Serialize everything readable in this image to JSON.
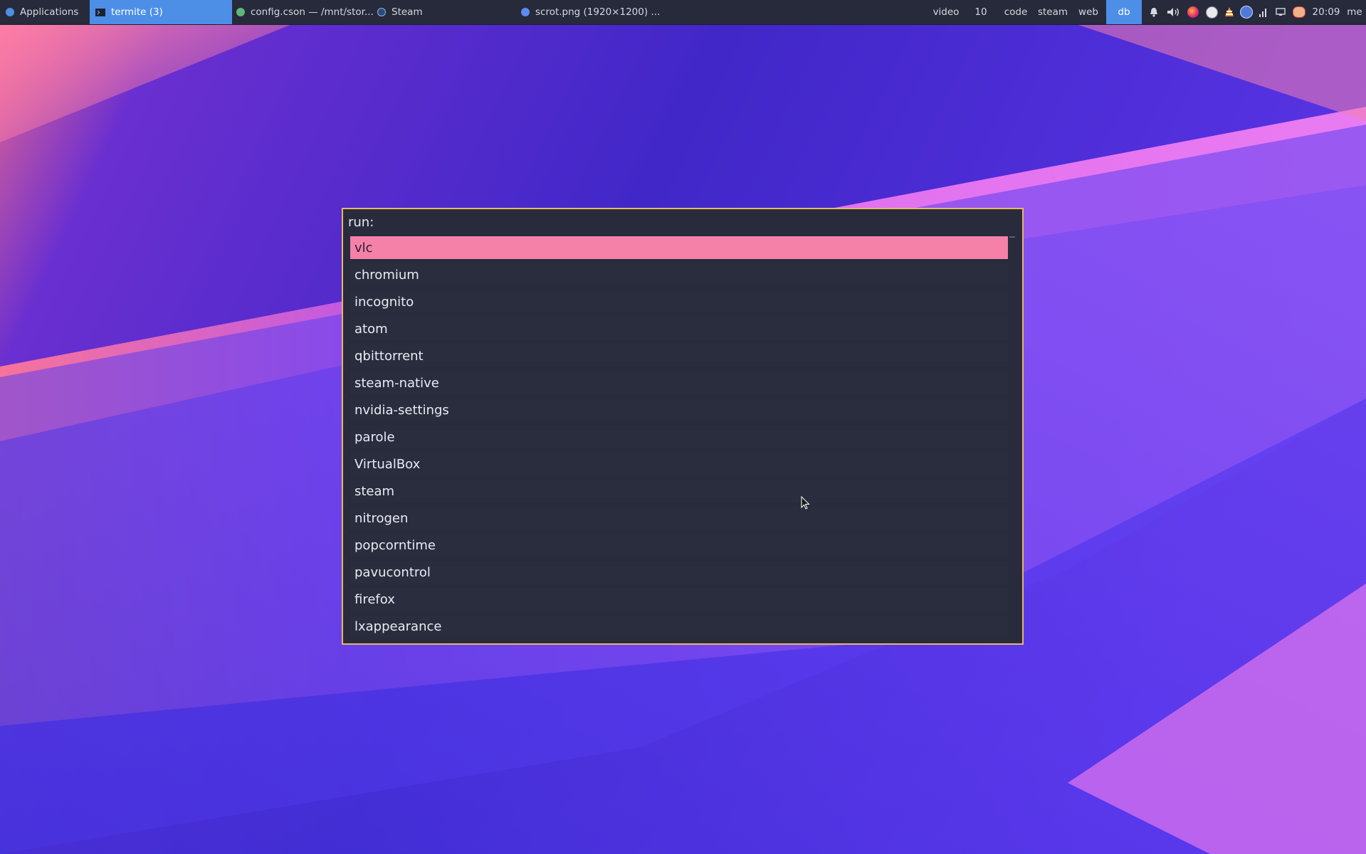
{
  "colors": {
    "panel_bg": "#262a3a",
    "active_bg": "#4d8fe6",
    "dialog_bg": "#282b3c",
    "dialog_border": "#e8b66a",
    "selection_bg": "#f581a8",
    "wallpaper_pink": "#f7739a",
    "wallpaper_blue": "#4a2fd6"
  },
  "panel": {
    "applications_label": "Applications",
    "windows": [
      {
        "label": "termite (3)",
        "icon": "terminal-icon",
        "active": true
      },
      {
        "label": "config.cson — /mnt/stor...",
        "icon": "atom-icon",
        "active": false
      },
      {
        "label": "Steam",
        "icon": "steam-icon",
        "active": false
      },
      {
        "label": "scrot.png (1920×1200) ...",
        "icon": "chromium-icon",
        "active": false
      }
    ],
    "workspaces": [
      {
        "label": "video",
        "active": false
      },
      {
        "label": "10",
        "active": false
      },
      {
        "label": "code",
        "active": false
      },
      {
        "label": "steam",
        "active": false
      },
      {
        "label": "web",
        "active": false
      },
      {
        "label": "db",
        "active": true
      }
    ],
    "tray_icons": [
      "bell-icon",
      "volume-icon",
      "firefox-icon",
      "steam-icon",
      "vlc-icon",
      "qbittorrent-icon",
      "network-icon",
      "display-icon",
      "popcorntime-icon"
    ],
    "clock": "20:09",
    "user": "me"
  },
  "run_dialog": {
    "prompt": "run:",
    "input_value": "",
    "items": [
      "vlc",
      "chromium",
      "incognito",
      "atom",
      "qbittorrent",
      "steam-native",
      "nvidia-settings",
      "parole",
      "VirtualBox",
      "steam",
      "nitrogen",
      "popcorntime",
      "pavucontrol",
      "firefox",
      "lxappearance"
    ],
    "selected_index": 0
  }
}
